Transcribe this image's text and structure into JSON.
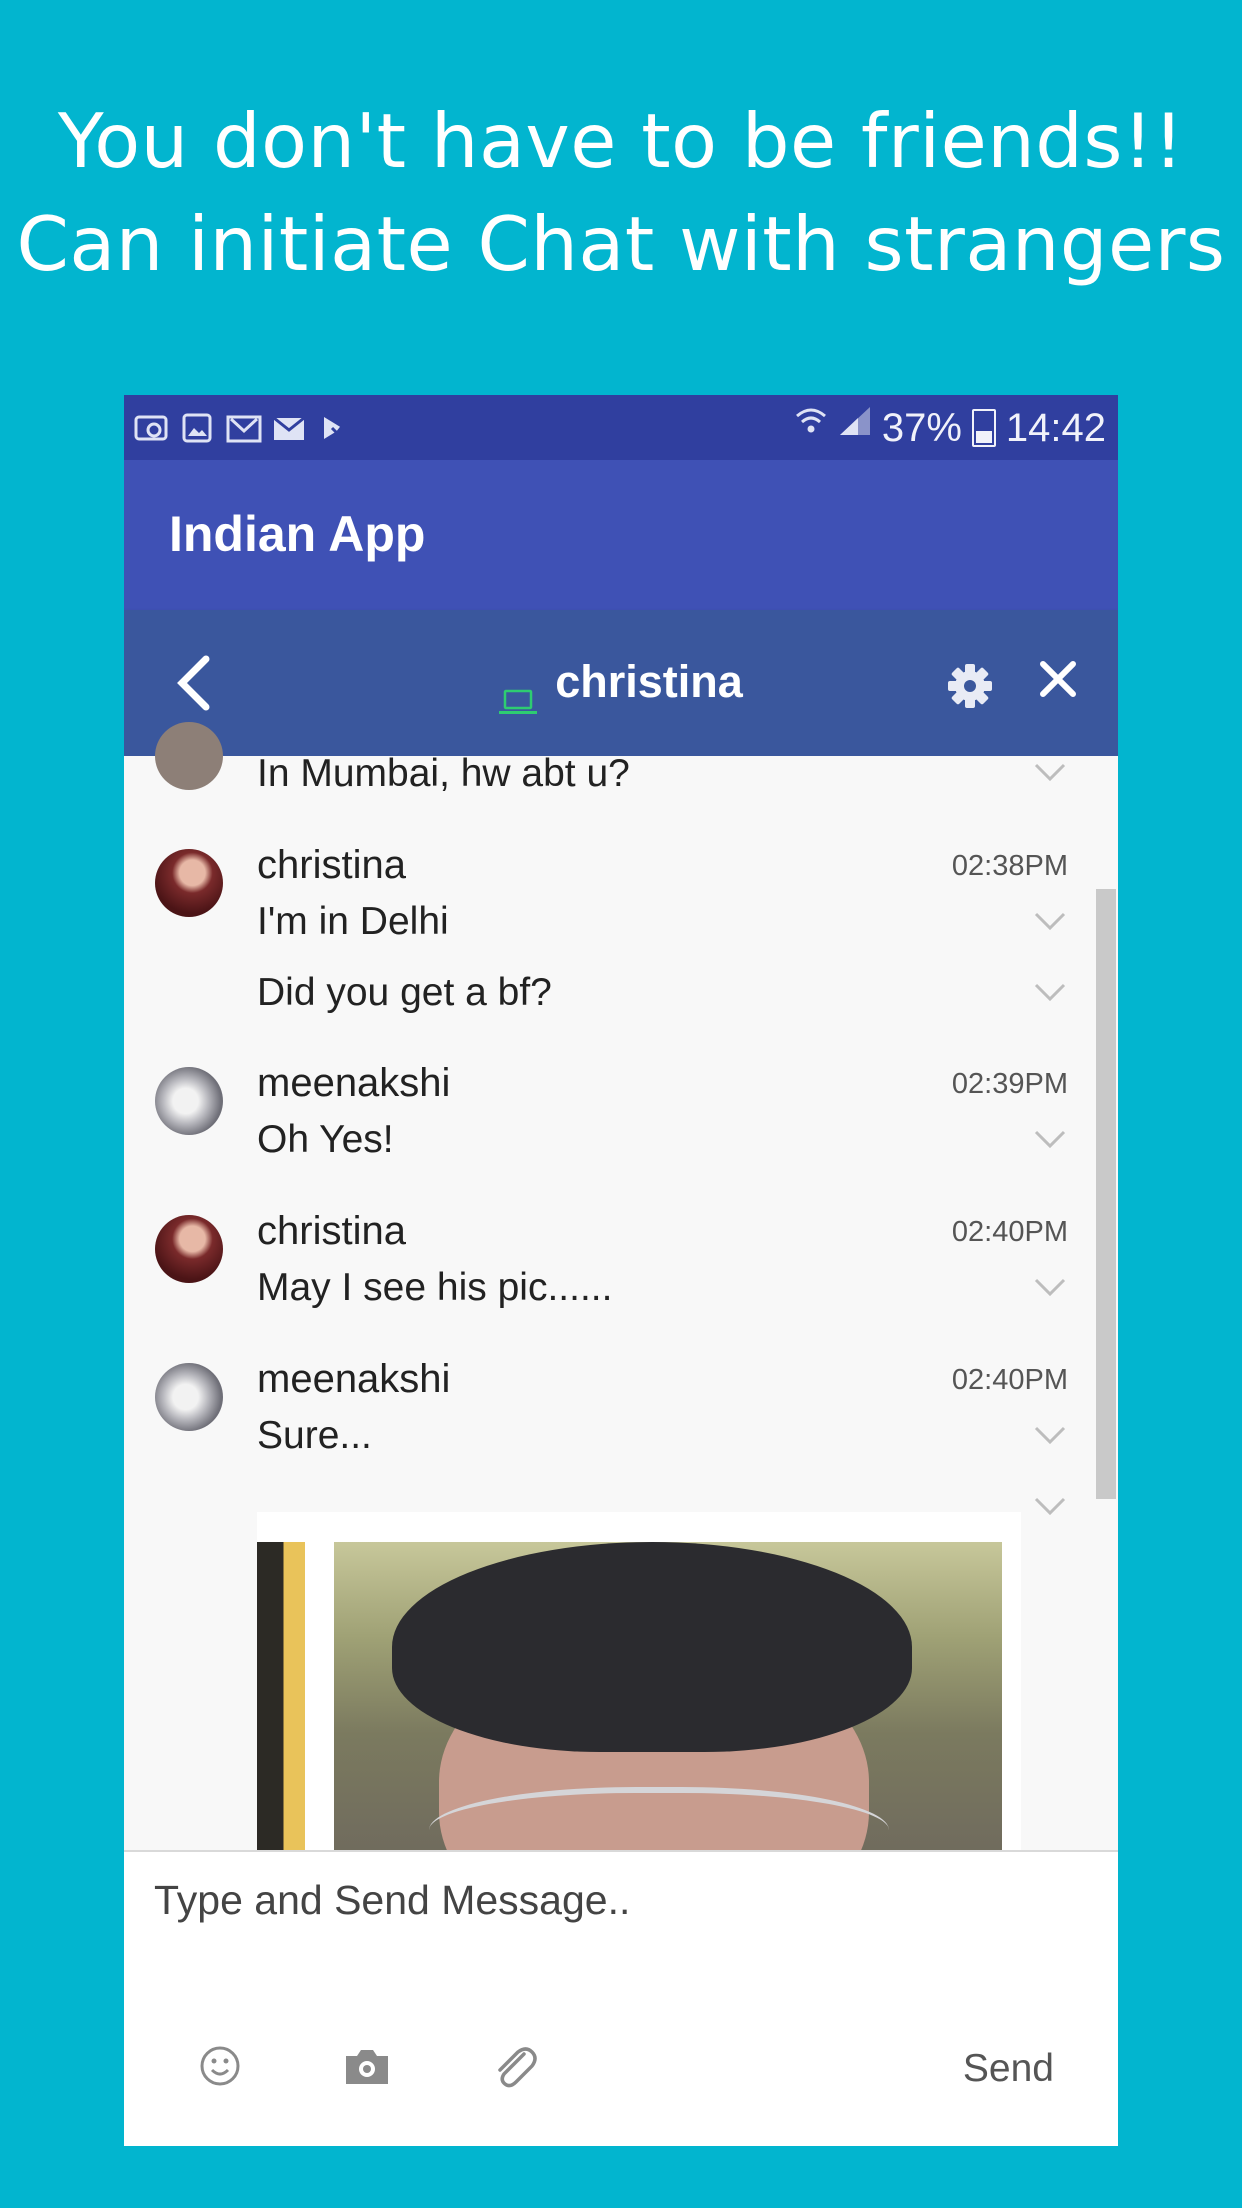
{
  "promo": {
    "line1": "You don't have to be friends!!",
    "line2": "Can initiate Chat with strangers"
  },
  "status_bar": {
    "battery": "37%",
    "time": "14:42",
    "notification_icons": [
      "cast-icon",
      "image-icon",
      "gmail-icon",
      "email-icon",
      "task-icon"
    ]
  },
  "app_bar": {
    "title": "Indian App"
  },
  "chat_header": {
    "contact_name": "christina",
    "presence_icon": "laptop-icon",
    "presence_color": "#2ecc71"
  },
  "messages": [
    {
      "sender": "",
      "time": "",
      "lines": [
        "In Mumbai, hw abt u?"
      ]
    },
    {
      "sender": "christina",
      "time": "02:38PM",
      "lines": [
        "I'm in Delhi",
        "Did you get a bf?"
      ]
    },
    {
      "sender": "meenakshi",
      "time": "02:39PM",
      "lines": [
        "Oh Yes!"
      ]
    },
    {
      "sender": "christina",
      "time": "02:40PM",
      "lines": [
        "May I see his pic......"
      ]
    },
    {
      "sender": "meenakshi",
      "time": "02:40PM",
      "lines": [
        "Sure..."
      ],
      "attachment": "photo"
    }
  ],
  "composer": {
    "placeholder": "Type and Send Message..",
    "send_label": "Send",
    "tools": [
      "smiley-icon",
      "camera-icon",
      "paperclip-icon"
    ]
  },
  "colors": {
    "background": "#02b5cf",
    "status_bar": "#303f9f",
    "app_bar": "#3f51b5",
    "chat_header": "#3a579d"
  }
}
